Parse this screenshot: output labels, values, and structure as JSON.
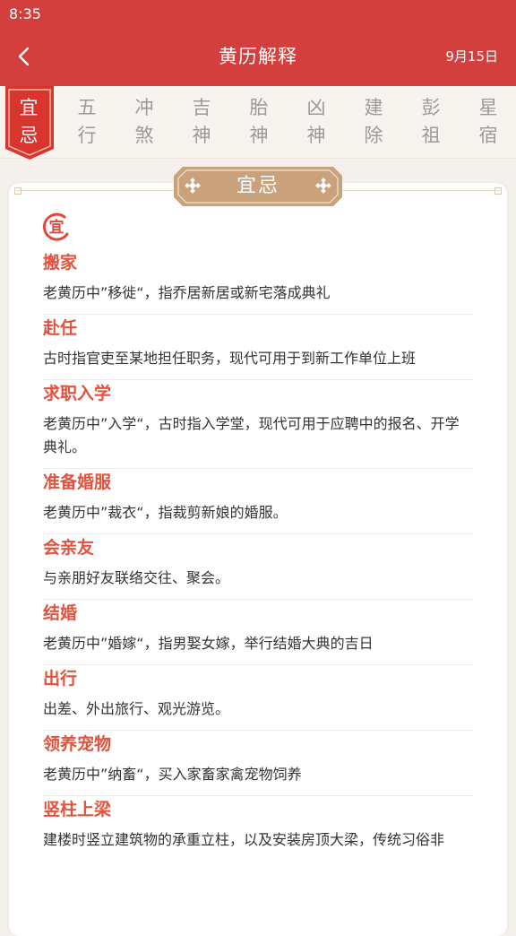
{
  "status_bar": {
    "time": "8:35"
  },
  "header": {
    "title": "黄历解释",
    "date": "9月15日"
  },
  "tabs": [
    {
      "label": "宜忌"
    },
    {
      "label": "五行"
    },
    {
      "label": "冲煞"
    },
    {
      "label": "吉神"
    },
    {
      "label": "胎神"
    },
    {
      "label": "凶神"
    },
    {
      "label": "建除"
    },
    {
      "label": "彭祖"
    },
    {
      "label": "星宿"
    }
  ],
  "section": {
    "title": "宜忌",
    "badge": "宜"
  },
  "entries": [
    {
      "title": "搬家",
      "desc": "老黄历中”移徙“，指乔居新居或新宅落成典礼"
    },
    {
      "title": "赴任",
      "desc": "古时指官吏至某地担任职务，现代可用于到新工作单位上班"
    },
    {
      "title": "求职入学",
      "desc": "老黄历中”入学“，古时指入学堂，现代可用于应聘中的报名、开学典礼。"
    },
    {
      "title": "准备婚服",
      "desc": "老黄历中”裁衣“，指裁剪新娘的婚服。"
    },
    {
      "title": "会亲友",
      "desc": "与亲朋好友联络交往、聚会。"
    },
    {
      "title": "结婚",
      "desc": "老黄历中”婚嫁“，指男娶女嫁，举行结婚大典的吉日"
    },
    {
      "title": "出行",
      "desc": "出差、外出旅行、观光游览。"
    },
    {
      "title": "领养宠物",
      "desc": "老黄历中”纳畜“，买入家畜家禽宠物饲养"
    },
    {
      "title": "竖柱上梁",
      "desc": "建楼时竖立建筑物的承重立柱，以及安装房顶大梁，传统习俗非"
    }
  ],
  "colors": {
    "header_red": "#d23f3c",
    "accent_red": "#e2523e",
    "banner_tan": "#c9a27c"
  }
}
